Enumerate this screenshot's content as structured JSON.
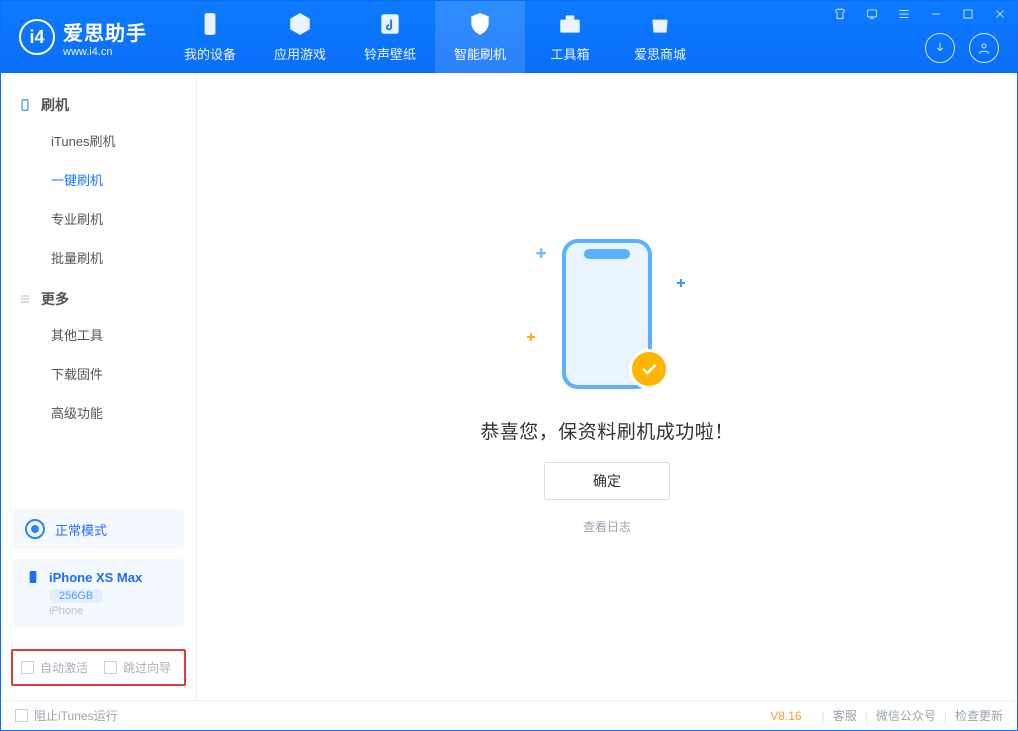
{
  "app": {
    "name_cn": "爱思助手",
    "name_en": "www.i4.cn"
  },
  "nav": {
    "items": [
      {
        "label": "我的设备",
        "icon": "device"
      },
      {
        "label": "应用游戏",
        "icon": "cube"
      },
      {
        "label": "铃声壁纸",
        "icon": "music"
      },
      {
        "label": "智能刷机",
        "icon": "shield",
        "active": true
      },
      {
        "label": "工具箱",
        "icon": "toolbox"
      },
      {
        "label": "爱思商城",
        "icon": "bag"
      }
    ]
  },
  "sidebar": {
    "sections": [
      {
        "title": "刷机",
        "icon": "phone",
        "items": [
          {
            "label": "iTunes刷机"
          },
          {
            "label": "一键刷机",
            "active": true
          },
          {
            "label": "专业刷机"
          },
          {
            "label": "批量刷机"
          }
        ]
      },
      {
        "title": "更多",
        "icon": "list",
        "items": [
          {
            "label": "其他工具"
          },
          {
            "label": "下载固件"
          },
          {
            "label": "高级功能"
          }
        ]
      }
    ],
    "mode": {
      "label": "正常模式"
    },
    "device": {
      "name": "iPhone XS Max",
      "capacity": "256GB",
      "type": "iPhone"
    },
    "checks": {
      "auto_activate": "自动激活",
      "skip_setup": "跳过向导"
    }
  },
  "main": {
    "success_text": "恭喜您，保资料刷机成功啦！",
    "ok_button": "确定",
    "log_link": "查看日志"
  },
  "footer": {
    "block_itunes": "阻止iTunes运行",
    "version": "V8.16",
    "links": {
      "support": "客服",
      "wechat": "微信公众号",
      "update": "检查更新"
    }
  }
}
